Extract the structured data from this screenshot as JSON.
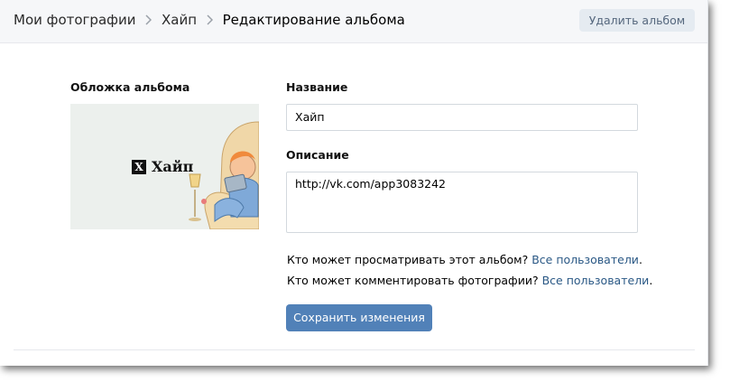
{
  "breadcrumb": {
    "items": [
      "Мои фотографии",
      "Хайп",
      "Редактирование альбома"
    ],
    "separator_icon": "chevron-right-icon"
  },
  "header": {
    "delete_label": "Удалить альбом"
  },
  "cover": {
    "label": "Обложка альбома",
    "title_logo": "X",
    "title": "Хайп"
  },
  "name": {
    "label": "Название",
    "value": "Хайп"
  },
  "description": {
    "label": "Описание",
    "value": "http://vk.com/app3083242"
  },
  "privacy": {
    "view_question": "Кто может просматривать этот альбом?",
    "view_value": "Все пользователи",
    "comment_question": "Кто может комментировать фотографии?",
    "comment_value": "Все пользователи",
    "period": "."
  },
  "actions": {
    "save_label": "Сохранить изменения"
  },
  "colors": {
    "header_bg": "#f6f7f9",
    "button_primary": "#5181b8",
    "button_secondary": "#e5ebf1",
    "link": "#2a5885"
  }
}
